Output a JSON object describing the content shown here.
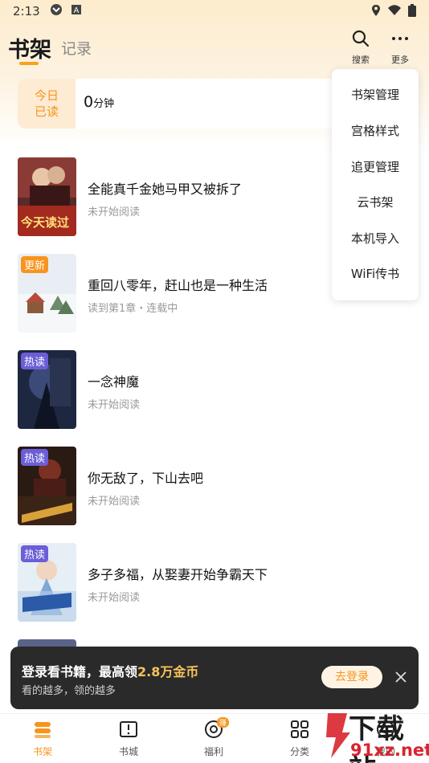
{
  "status_bar": {
    "time": "2:13"
  },
  "header": {
    "tab_active": "书架",
    "tab_inactive": "记录",
    "search_label": "搜索",
    "more_label": "更多"
  },
  "reading": {
    "today_line1": "今日",
    "today_line2": "已读",
    "minutes": "0",
    "unit": "分钟"
  },
  "books": [
    {
      "title": "全能真千金她马甲又被拆了",
      "status": "未开始阅读",
      "badge": "",
      "cover_text": "今天读过"
    },
    {
      "title": "重回八零年，赶山也是一种生活",
      "status": "读到第1章・连载中",
      "badge": "更新",
      "cover_text": ""
    },
    {
      "title": "一念神魔",
      "status": "未开始阅读",
      "badge": "热读",
      "cover_text": ""
    },
    {
      "title": "你无敌了，下山去吧",
      "status": "未开始阅读",
      "badge": "热读",
      "cover_text": ""
    },
    {
      "title": "多子多福，从娶妻开始争霸天下",
      "status": "未开始阅读",
      "badge": "热读",
      "cover_text": ""
    }
  ],
  "menu": {
    "items": [
      "书架管理",
      "宫格样式",
      "追更管理",
      "云书架",
      "本机导入",
      "WiFi传书"
    ]
  },
  "login_banner": {
    "title_prefix": "登录看书籍，最高领",
    "title_highlight": "2.8万金币",
    "subtitle": "看的越多，领的越多",
    "button": "去登录"
  },
  "bottom_nav": {
    "items": [
      "书架",
      "书城",
      "福利",
      "分类",
      "我的"
    ],
    "welfare_badge": "赚"
  },
  "watermark": {
    "line1": "下载站",
    "line2": "91xz.net"
  },
  "colors": {
    "accent": "#f7941d",
    "hot_badge": "#6a5fd7",
    "banner_bg": "#2a2a2a"
  }
}
